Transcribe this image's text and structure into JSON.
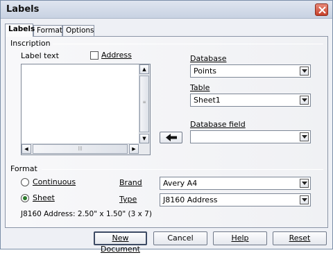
{
  "window": {
    "title": "Labels"
  },
  "tabs": [
    {
      "label": "Labels",
      "active": true
    },
    {
      "label": "Format",
      "active": false
    },
    {
      "label": "Options",
      "active": false
    }
  ],
  "inscription": {
    "group_label": "Inscription",
    "label_text_label": "Label text",
    "address_checkbox": {
      "label": "Address",
      "checked": false
    },
    "label_text_value": ""
  },
  "database": {
    "database_label": "Database",
    "database_value": "Points",
    "table_label": "Table",
    "table_value": "Sheet1",
    "field_label": "Database field",
    "field_value": "",
    "insert_arrow": "left-arrow-icon"
  },
  "format": {
    "group_label": "Format",
    "continuous_label": "Continuous",
    "sheet_label": "Sheet",
    "selected": "sheet",
    "brand_label": "Brand",
    "brand_value": "Avery A4",
    "type_label": "Type",
    "type_value": "J8160 Address",
    "info_text": "J8160 Address: 2.50\" x 1.50\" (3 x 7)"
  },
  "buttons": {
    "new_document": "New Document",
    "cancel": "Cancel",
    "help": "Help",
    "reset": "Reset"
  },
  "colors": {
    "radio_selected": "#2d7a2d",
    "close_button": "#c6402a"
  }
}
